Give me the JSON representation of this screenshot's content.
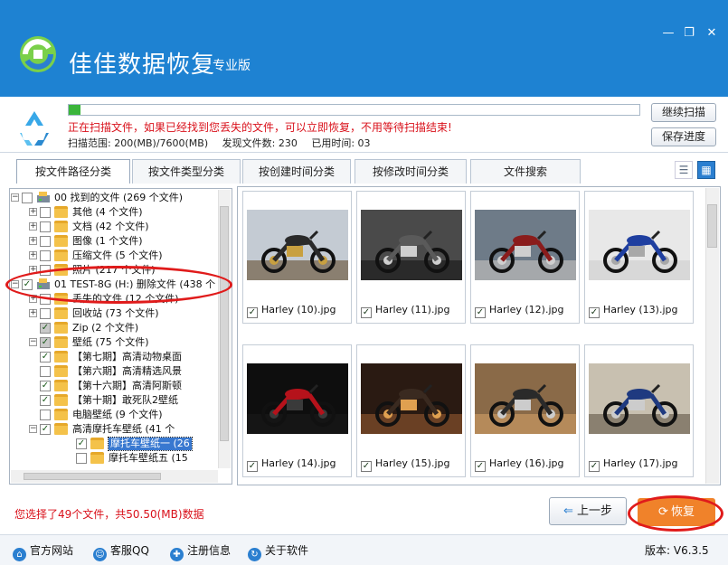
{
  "app": {
    "title": "佳佳数据恢复",
    "edition": "专业版"
  },
  "window_buttons": {
    "minimize": "—",
    "maximize": "❐",
    "close": "✕"
  },
  "scan": {
    "progress": 0.02,
    "message": "正在扫描文件，如果已经找到您丢失的文件，可以立即恢复，不用等待扫描结束!",
    "range_label": "扫描范围: 200(MB)/7600(MB)",
    "found_label": "发现文件数: 230",
    "time_label": "已用时间: 03",
    "continue_button": "继续扫描",
    "save_button": "保存进度"
  },
  "tabs": [
    "按文件路径分类",
    "按文件类型分类",
    "按创建时间分类",
    "按修改时间分类",
    "文件搜索"
  ],
  "view_buttons": {
    "list": "☰",
    "grid": "▦"
  },
  "tree": [
    {
      "label": "00 找到的文件  (269 个文件)",
      "level": 0,
      "expander": "−",
      "check": "",
      "icon": "drive"
    },
    {
      "label": "其他   (4 个文件)",
      "level": 1,
      "expander": "+",
      "check": "",
      "icon": "folder"
    },
    {
      "label": "文档   (42 个文件)",
      "level": 1,
      "expander": "+",
      "check": "",
      "icon": "folder"
    },
    {
      "label": "图像   (1 个文件)",
      "level": 1,
      "expander": "+",
      "check": "",
      "icon": "folder"
    },
    {
      "label": "压缩文件   (5 个文件)",
      "level": 1,
      "expander": "+",
      "check": "",
      "icon": "folder"
    },
    {
      "label": "照片   (217 个文件)",
      "level": 1,
      "expander": "+",
      "check": "",
      "icon": "folder"
    },
    {
      "label": "01 TEST-8G (H:) 删除文件 (438 个",
      "level": 0,
      "expander": "−",
      "check": "✓",
      "icon": "drive"
    },
    {
      "label": "丢失的文件   (12 个文件)",
      "level": 1,
      "expander": "+",
      "check": "",
      "icon": "folder"
    },
    {
      "label": "回收站   (73 个文件)",
      "level": 1,
      "expander": "+",
      "check": "",
      "icon": "folder"
    },
    {
      "label": "Zip   (2 个文件)",
      "level": 1,
      "expander": "",
      "check": "✓",
      "icon": "folder"
    },
    {
      "label": "壁纸   (75 个文件)",
      "level": 1,
      "expander": "−",
      "check": "✓",
      "icon": "folder"
    },
    {
      "label": "【第七期】高清动物桌面",
      "level": 2,
      "expander": "",
      "check": "✓",
      "icon": "folder"
    },
    {
      "label": "【第六期】高清精选风景",
      "level": 2,
      "expander": "",
      "check": "",
      "icon": "folder"
    },
    {
      "label": "【第十六期】高清阿斯顿",
      "level": 2,
      "expander": "",
      "check": "✓",
      "icon": "folder"
    },
    {
      "label": "【第十期】敢死队2壁纸",
      "level": 2,
      "expander": "",
      "check": "✓",
      "icon": "folder"
    },
    {
      "label": "电脑壁纸   (9 个文件)",
      "level": 2,
      "expander": "",
      "check": "",
      "icon": "folder"
    },
    {
      "label": "高清摩托车壁纸   (41 个",
      "level": 2,
      "expander": "−",
      "check": "✓",
      "icon": "folder"
    },
    {
      "label": "摩托车壁纸一   (26",
      "level": 3,
      "expander": "",
      "check": "✓",
      "icon": "folder",
      "selected": true
    },
    {
      "label": "摩托车壁纸五   (15",
      "level": 3,
      "expander": "",
      "check": "",
      "icon": "folder"
    }
  ],
  "gallery": [
    {
      "name": "Harley (10).jpg",
      "checked": true,
      "bg": "#c4cbd3",
      "ground": "#8a7f70",
      "bike": "#2a2a2a",
      "accent": "#c8a040"
    },
    {
      "name": "Harley (11).jpg",
      "checked": true,
      "bg": "#4a4a4a",
      "ground": "#2a2a2a",
      "bike": "#5a5a5a",
      "accent": "#cfcfcf"
    },
    {
      "name": "Harley (12).jpg",
      "checked": true,
      "bg": "#6e7b88",
      "ground": "#a5a8ab",
      "bike": "#8a1c1c",
      "accent": "#cfcfcf"
    },
    {
      "name": "Harley (13).jpg",
      "checked": true,
      "bg": "#e8e8e8",
      "ground": "#d8d8d8",
      "bike": "#1f3fa0",
      "accent": "#a8a8a8"
    },
    {
      "name": "Harley (14).jpg",
      "checked": true,
      "bg": "#0e0e0e",
      "ground": "#151515",
      "bike": "#b5121b",
      "accent": "#3a3a3a"
    },
    {
      "name": "Harley (15).jpg",
      "checked": true,
      "bg": "#2a1a12",
      "ground": "#6a4024",
      "bike": "#3a2a20",
      "accent": "#e0a050"
    },
    {
      "name": "Harley (16).jpg",
      "checked": true,
      "bg": "#8a6a48",
      "ground": "#b58a5a",
      "bike": "#2a2a2a",
      "accent": "#cccccc"
    },
    {
      "name": "Harley (17).jpg",
      "checked": true,
      "bg": "#c8c0b0",
      "ground": "#8a8070",
      "bike": "#1f3a80",
      "accent": "#cccccc"
    }
  ],
  "footer": {
    "selection_text": "您选择了49个文件，共50.50(MB)数据",
    "prev_button": "上一步",
    "prev_icon": "⇐",
    "recover_button": "恢复",
    "recover_icon": "⟳"
  },
  "statusbar": {
    "items": [
      {
        "label": "官方网站",
        "icon": "⌂"
      },
      {
        "label": "客服QQ",
        "icon": "☺"
      },
      {
        "label": "注册信息",
        "icon": "✚"
      },
      {
        "label": "关于软件",
        "icon": "↻"
      }
    ],
    "version": "版本: V6.3.5"
  },
  "colors": {
    "titlebar": "#1e82d2",
    "highlight": "#e01b1b",
    "recover": "#f0822a"
  }
}
